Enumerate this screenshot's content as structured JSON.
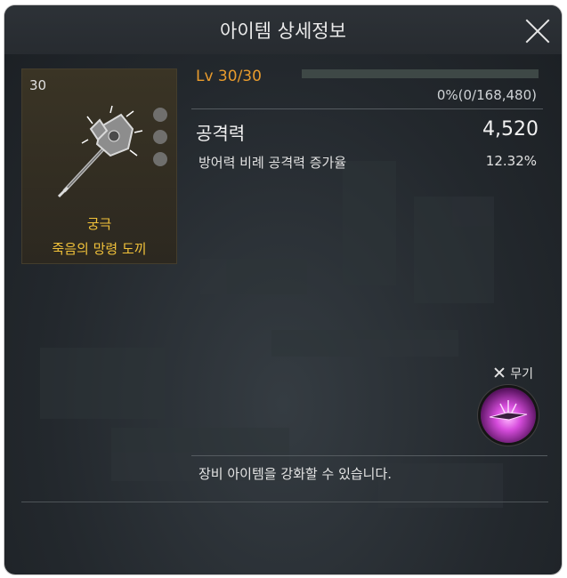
{
  "window": {
    "title": "아이템 상세정보",
    "close_icon": "close-icon"
  },
  "item": {
    "level_badge": "30",
    "grade": "궁극",
    "name": "죽음의 망령 도끼",
    "icon": "axe-weapon-icon",
    "sockets": 3
  },
  "level": {
    "text": "Lv 30/30",
    "exp_text": "0%(0/168,480)",
    "exp_fraction": 0.0
  },
  "stats": {
    "main": {
      "name": "공격력",
      "value": "4,520"
    },
    "sub": {
      "name": "방어력 비례 공격력 증가율",
      "value": "12.32%"
    }
  },
  "slot": {
    "label": "무기",
    "icon": "weapon-slot-icon"
  },
  "description": "장비 아이템을 강화할 수 있습니다.",
  "colors": {
    "level": "#e89b2d",
    "grade": "#f2c23a",
    "exp_bar": "#6ea17a"
  }
}
